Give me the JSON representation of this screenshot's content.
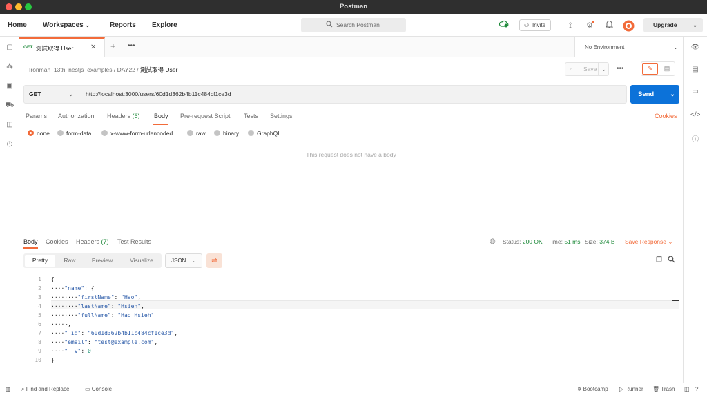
{
  "window": {
    "title": "Postman"
  },
  "header": {
    "home": "Home",
    "workspaces": "Workspaces",
    "reports": "Reports",
    "explore": "Explore",
    "search_placeholder": "Search Postman",
    "invite": "Invite",
    "upgrade": "Upgrade"
  },
  "tabs": [
    {
      "method": "GET",
      "title": "測試取得 User"
    }
  ],
  "environment": "No Environment",
  "breadcrumb": {
    "collection": "Ironman_13th_nestjs_examples",
    "folder": "DAY22",
    "request": "測試取得 User"
  },
  "toolbar": {
    "save": "Save"
  },
  "request": {
    "method": "GET",
    "url": "http://localhost:3000/users/60d1d362b4b11c484cf1ce3d",
    "send": "Send",
    "tabs": {
      "params": "Params",
      "authorization": "Authorization",
      "headers": "Headers",
      "headers_count": "(6)",
      "body": "Body",
      "prerequest": "Pre-request Script",
      "tests": "Tests",
      "settings": "Settings",
      "cookies": "Cookies"
    },
    "body_types": [
      "none",
      "form-data",
      "x-www-form-urlencoded",
      "raw",
      "binary",
      "GraphQL"
    ],
    "body_selected": "none",
    "empty_body_message": "This request does not have a body"
  },
  "response": {
    "tabs": {
      "body": "Body",
      "cookies": "Cookies",
      "headers": "Headers",
      "headers_count": "(7)",
      "test_results": "Test Results"
    },
    "status_label": "Status:",
    "status_value": "200 OK",
    "time_label": "Time:",
    "time_value": "51 ms",
    "size_label": "Size:",
    "size_value": "374 B",
    "save_response": "Save Response",
    "views": [
      "Pretty",
      "Raw",
      "Preview",
      "Visualize"
    ],
    "format": "JSON",
    "lines": [
      "1",
      "2",
      "3",
      "4",
      "5",
      "6",
      "7",
      "8",
      "9",
      "10"
    ],
    "code": {
      "name_key": "\"name\"",
      "firstName_key": "\"firstName\"",
      "firstName_val": "\"Hao\"",
      "lastName_key": "\"lastName\"",
      "lastName_val": "\"Hsieh\"",
      "fullName_key": "\"fullName\"",
      "fullName_val": "\"Hao Hsieh\"",
      "id_key": "\"_id\"",
      "id_val": "\"60d1d362b4b11c484cf1ce3d\"",
      "email_key": "\"email\"",
      "email_val": "\"test@example.com\"",
      "v_key": "\"__v\"",
      "v_val": "0"
    }
  },
  "statusbar": {
    "find_replace": "Find and Replace",
    "console": "Console",
    "bootcamp": "Bootcamp",
    "runner": "Runner",
    "trash": "Trash"
  },
  "colors": {
    "accent": "#f26b3a",
    "send_blue": "#0c72d9",
    "status_green": "#1f8a3b"
  }
}
